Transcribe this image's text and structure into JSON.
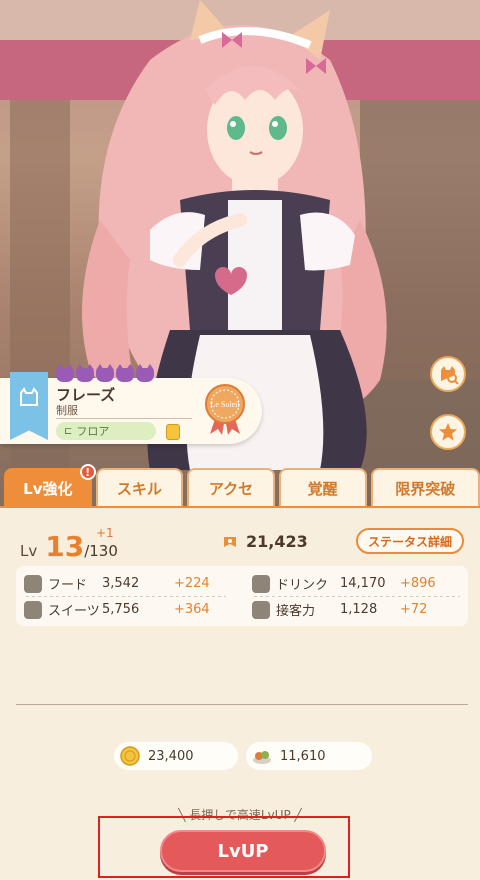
{
  "character": {
    "name": "フレーズ",
    "outfit": "制服",
    "role_tag": "フロア",
    "medal_text": "Le Soleil"
  },
  "tabs": [
    {
      "label": "Lv強化",
      "active": true,
      "badge": "!"
    },
    {
      "label": "スキル"
    },
    {
      "label": "アクセ"
    },
    {
      "label": "覚醒"
    },
    {
      "label": "限界突破"
    }
  ],
  "level": {
    "label": "Lv",
    "current": "13",
    "max": "/130",
    "plus": "+1"
  },
  "gold": "21,423",
  "status_button": "ステータス詳細",
  "stats": [
    {
      "label": "フード",
      "value": "3,542",
      "bonus": "+224",
      "icon": "food-icon"
    },
    {
      "label": "ドリンク",
      "value": "14,170",
      "bonus": "+896",
      "icon": "drink-icon"
    },
    {
      "label": "スイーツ",
      "value": "5,756",
      "bonus": "+364",
      "icon": "sweets-icon"
    },
    {
      "label": "接客力",
      "value": "1,128",
      "bonus": "+72",
      "icon": "service-icon"
    }
  ],
  "costs": {
    "coins": "23,400",
    "food": "11,610"
  },
  "hint": "╲ 長押しで高速LvUP ╱",
  "lvup_button": "LvUP",
  "colors": {
    "accent": "#ee8e3a",
    "button": "#e45a5a",
    "highlight": "#e02020"
  }
}
